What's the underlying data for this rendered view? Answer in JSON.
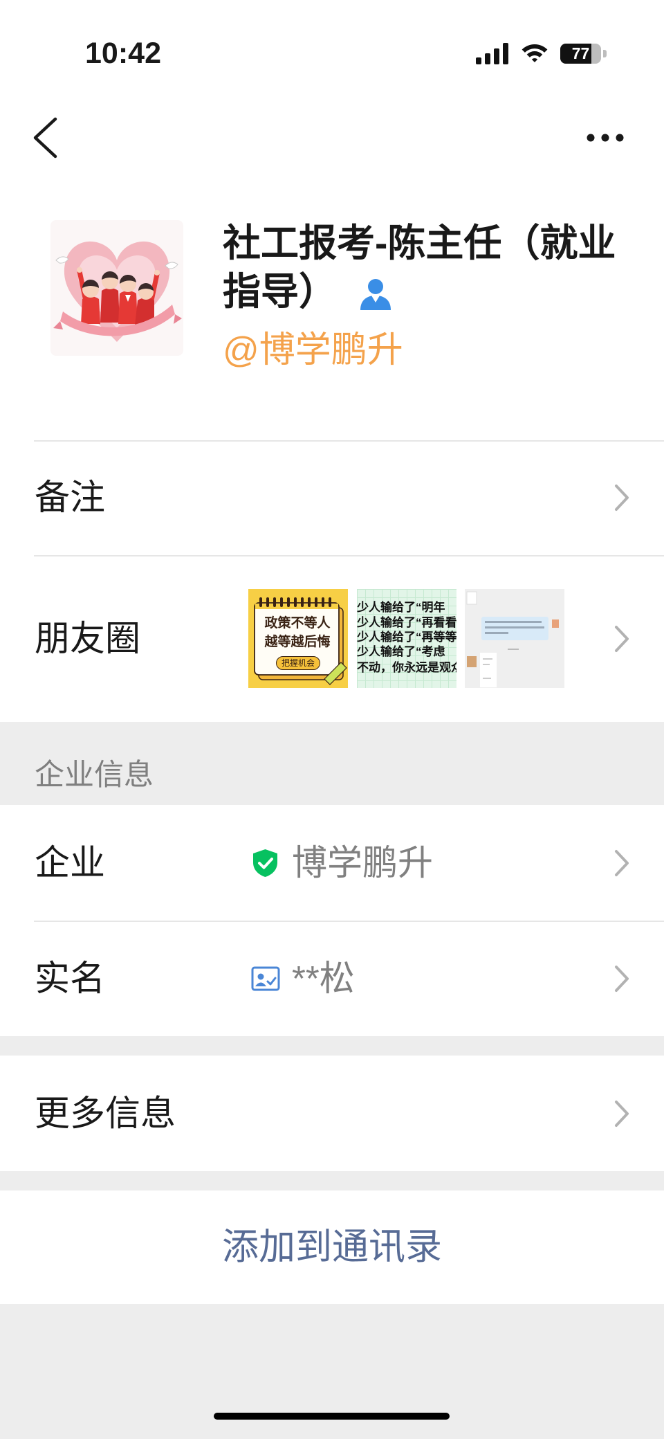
{
  "status_bar": {
    "time": "10:42",
    "battery_level": "77",
    "icons": [
      "signal-icon",
      "wifi-icon",
      "battery-icon"
    ]
  },
  "nav": {
    "back_icon": "chevron-left-icon",
    "more_icon": "more-dots-icon"
  },
  "profile": {
    "avatar_icon": "avatar-illustration",
    "name": "社工报考-陈主任（就业指导）",
    "name_badge_icon": "person-icon",
    "company_tag": "@博学鹏升"
  },
  "rows": {
    "remark": {
      "label": "备注"
    },
    "moments": {
      "label": "朋友圈",
      "thumbnails": [
        {
          "lines": [
            "政策不等人",
            "越等越后悔"
          ],
          "button": "把握机会"
        },
        {
          "lines": [
            "少人输给了“明年",
            "少人输给了“再看看",
            "少人输给了“再等等",
            "少人输给了“考虑",
            "不动，你永远是观众"
          ]
        },
        {}
      ]
    }
  },
  "enterprise": {
    "header": "企业信息",
    "company": {
      "label": "企业",
      "value": "博学鹏升",
      "icon": "verified-shield-icon"
    },
    "real_name": {
      "label": "实名",
      "value": "**松",
      "icon": "id-card-icon"
    }
  },
  "more_info": {
    "label": "更多信息"
  },
  "action": {
    "add_to_contacts": "添加到通讯录"
  },
  "colors": {
    "link_blue": "#576B95",
    "company_tag_orange": "#F4A24B",
    "verified_green": "#07C160",
    "id_card_blue": "#4A86D6",
    "badge_blue": "#3A8EE6",
    "background_gray": "#EDEDED"
  }
}
